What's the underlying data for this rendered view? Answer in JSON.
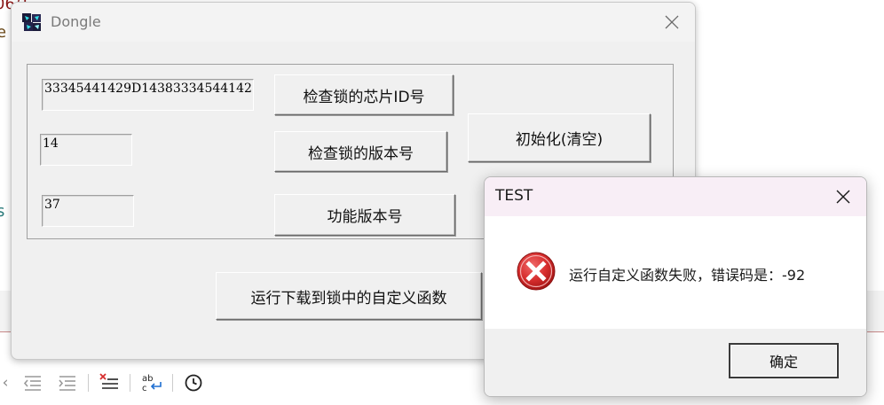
{
  "background": {
    "fragment_top": "06/¿.",
    "fragment_second": "e",
    "fragment_third": "s"
  },
  "dongle": {
    "title": "Dongle",
    "chip_id_value": "33345441429D14383334544142",
    "version_value": "14",
    "func_version_value": "37",
    "btn_check_chip_id": "检查锁的芯片ID号",
    "btn_check_version": "检查锁的版本号",
    "btn_func_version": "功能版本号",
    "btn_initialize": "初始化(清空)",
    "btn_run_custom": "运行下载到锁中的自定义函数"
  },
  "message_box": {
    "title": "TEST",
    "message": "运行自定义函数失败，错误码是：-92",
    "ok_label": "确定",
    "icon": "error-icon"
  },
  "colors": {
    "error_red": "#d62d2d",
    "msg_titlebar": "#f8eef6",
    "window_bg": "#f0f0f0"
  },
  "toolbar_icons": [
    "unindent-icon",
    "indent-icon",
    "clear-list-icon",
    "replace-icon",
    "clock-icon"
  ]
}
